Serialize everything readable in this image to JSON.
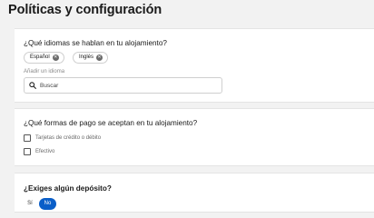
{
  "page": {
    "title": "Políticas y configuración"
  },
  "languages": {
    "question": "¿Qué idiomas se hablan en tu alojamiento?",
    "chips": [
      "Español",
      "Inglés"
    ],
    "add_label": "Añadir un idioma",
    "search_placeholder": "Buscar"
  },
  "payments": {
    "question": "¿Qué formas de pago se aceptan en tu alojamiento?",
    "options": [
      "Tarjetas de crédito o débito",
      "Efectivo"
    ]
  },
  "deposit": {
    "question": "¿Exiges algún depósito?",
    "options": {
      "yes": "Sí",
      "no": "No"
    },
    "selected": "No"
  },
  "colors": {
    "accent": "#0a5ec8",
    "background": "#f2f2f2",
    "card": "#ffffff"
  }
}
